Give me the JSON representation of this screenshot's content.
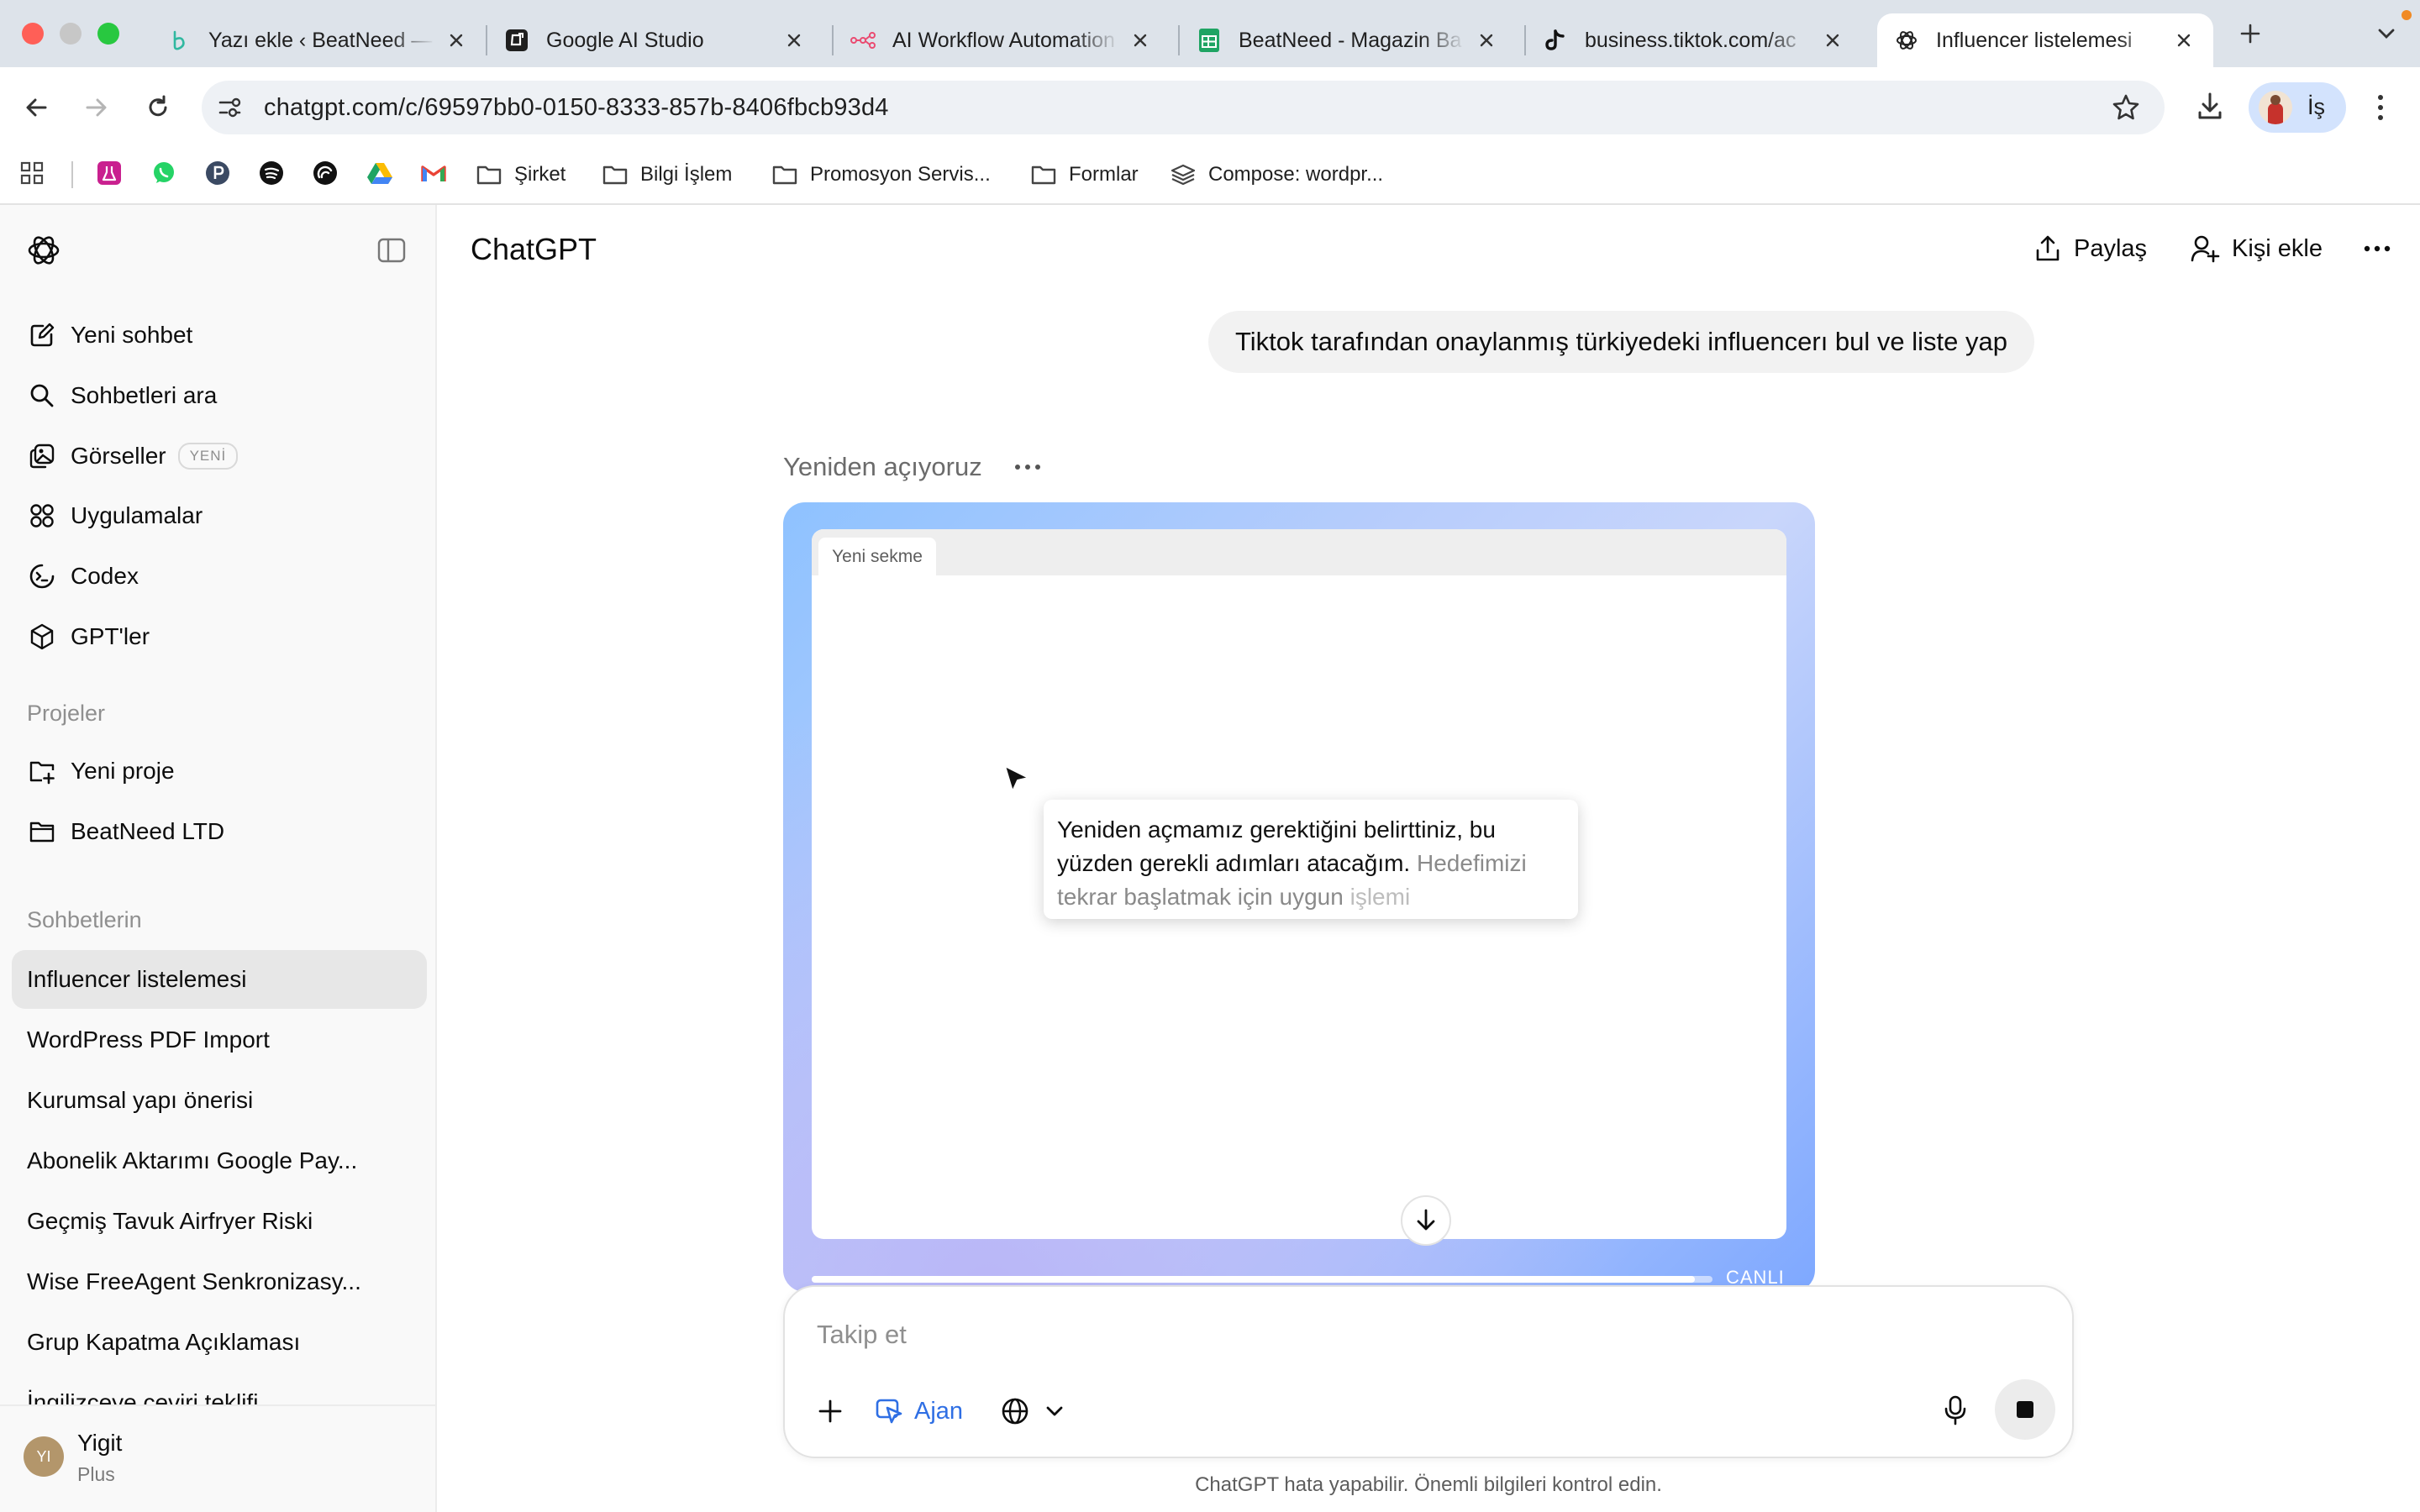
{
  "browser": {
    "tabs": [
      {
        "title": "Yazı ekle ‹ BeatNeed — WordPress",
        "icon": "beatneed-icon"
      },
      {
        "title": "Google AI Studio",
        "icon": "ai-studio-icon"
      },
      {
        "title": "AI Workflow Automation",
        "icon": "n8n-icon"
      },
      {
        "title": "BeatNeed - Magazin Ba",
        "icon": "google-sheets-icon"
      },
      {
        "title": "business.tiktok.com/ac",
        "icon": "tiktok-icon"
      },
      {
        "title": "Influencer listelemesi",
        "icon": "openai-icon"
      }
    ],
    "url": "chatgpt.com/c/69597bb0-0150-8333-857b-8406fbcb93d4",
    "profile_label": "İş",
    "bookmarks": [
      {
        "label": "Şirket",
        "icon": "folder-icon"
      },
      {
        "label": "Bilgi İşlem",
        "icon": "folder-icon"
      },
      {
        "label": "Promosyon Servis...",
        "icon": "folder-icon"
      },
      {
        "label": "Formlar",
        "icon": "folder-icon"
      },
      {
        "label": "Compose: wordpr...",
        "icon": "stack-icon"
      }
    ],
    "colors": {
      "tabstrip": "#dde3ea",
      "omnibox": "#eef1f5"
    }
  },
  "sidebar": {
    "nav": [
      {
        "label": "Yeni sohbet",
        "icon": "new-chat-icon"
      },
      {
        "label": "Sohbetleri ara",
        "icon": "search-icon"
      },
      {
        "label": "Görseller",
        "icon": "images-icon",
        "badge": "YENİ"
      },
      {
        "label": "Uygulamalar",
        "icon": "apps-icon"
      },
      {
        "label": "Codex",
        "icon": "codex-icon"
      },
      {
        "label": "GPT'ler",
        "icon": "gpts-icon"
      }
    ],
    "projects_label": "Projeler",
    "projects": [
      {
        "label": "Yeni proje",
        "icon": "new-project-icon"
      },
      {
        "label": "BeatNeed LTD",
        "icon": "folder-icon"
      }
    ],
    "chats_label": "Sohbetlerin",
    "chats": [
      "Influencer listelemesi",
      "WordPress PDF Import",
      "Kurumsal yapı önerisi",
      "Abonelik Aktarımı Google Pay...",
      "Geçmiş Tavuk Airfryer Riski",
      "Wise FreeAgent Senkronizasy...",
      "Grup Kapatma Açıklaması",
      "İngilizceye çeviri teklifi"
    ],
    "user": {
      "initials": "YI",
      "name": "Yigit",
      "plan": "Plus"
    }
  },
  "main": {
    "title": "ChatGPT",
    "share_label": "Paylaş",
    "add_person_label": "Kişi ekle",
    "user_message": "Tiktok tarafından onaylanmış türkiyedeki influencerı bul ve liste yap",
    "agent_status": "Yeniden açıyoruz",
    "virtual_browser": {
      "tab_label": "Yeni sekme",
      "caption_main": "Yeniden açmamız gerektiğini belirttiniz, bu yüzden gerekli adımları atacağım.",
      "caption_faded": "Hedefimizi tekrar başlatmak için uygun",
      "caption_faded_more": "işlemi",
      "live_label": "CANLI",
      "progress": 0.98
    },
    "composer": {
      "placeholder": "Takip et",
      "agent_label": "Ajan"
    },
    "disclaimer": "ChatGPT hata yapabilir. Önemli bilgileri kontrol edin."
  }
}
